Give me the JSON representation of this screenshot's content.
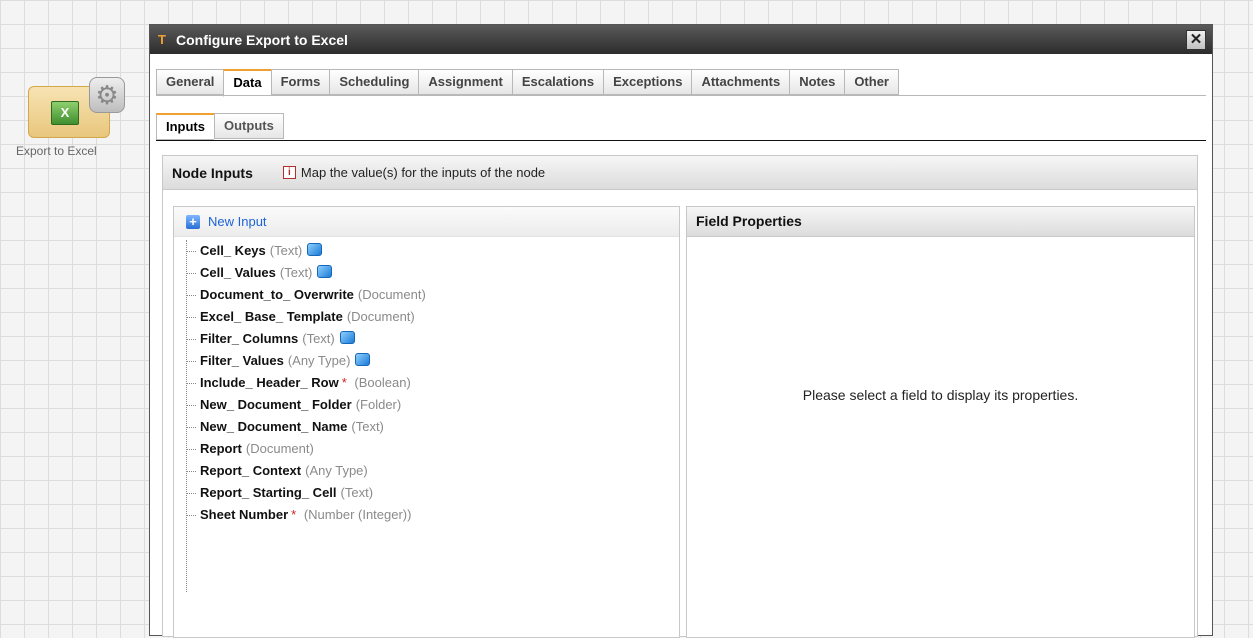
{
  "canvas": {
    "node_label": "Export to Excel"
  },
  "dialog": {
    "title": "Configure Export to Excel",
    "close_symbol": "✕",
    "tabs": [
      "General",
      "Data",
      "Forms",
      "Scheduling",
      "Assignment",
      "Escalations",
      "Exceptions",
      "Attachments",
      "Notes",
      "Other"
    ],
    "active_tab": "Data",
    "subtabs": [
      "Inputs",
      "Outputs"
    ],
    "active_subtab": "Inputs"
  },
  "node_inputs": {
    "title": "Node Inputs",
    "info_text": "Map the value(s) for the inputs of the node",
    "new_input_label": "New Input",
    "items": [
      {
        "name": "Cell_ Keys",
        "type": "(Text)",
        "required": false,
        "list": true
      },
      {
        "name": "Cell_ Values",
        "type": "(Text)",
        "required": false,
        "list": true
      },
      {
        "name": "Document_to_ Overwrite",
        "type": "(Document)",
        "required": false,
        "list": false
      },
      {
        "name": "Excel_ Base_ Template",
        "type": "(Document)",
        "required": false,
        "list": false
      },
      {
        "name": "Filter_ Columns",
        "type": "(Text)",
        "required": false,
        "list": true
      },
      {
        "name": "Filter_ Values",
        "type": "(Any Type)",
        "required": false,
        "list": true
      },
      {
        "name": "Include_ Header_ Row",
        "type": "(Boolean)",
        "required": true,
        "list": false
      },
      {
        "name": "New_ Document_ Folder",
        "type": "(Folder)",
        "required": false,
        "list": false
      },
      {
        "name": "New_ Document_ Name",
        "type": "(Text)",
        "required": false,
        "list": false
      },
      {
        "name": "Report",
        "type": "(Document)",
        "required": false,
        "list": false
      },
      {
        "name": "Report_ Context",
        "type": "(Any Type)",
        "required": false,
        "list": false
      },
      {
        "name": "Report_ Starting_ Cell",
        "type": "(Text)",
        "required": false,
        "list": false
      },
      {
        "name": "Sheet Number",
        "type": "(Number (Integer))",
        "required": true,
        "list": false
      }
    ]
  },
  "field_properties": {
    "title": "Field Properties",
    "empty_message": "Please select a field to display its properties."
  },
  "colors": {
    "accent": "#f0a030",
    "link": "#1d63d6",
    "required": "#d02020"
  }
}
